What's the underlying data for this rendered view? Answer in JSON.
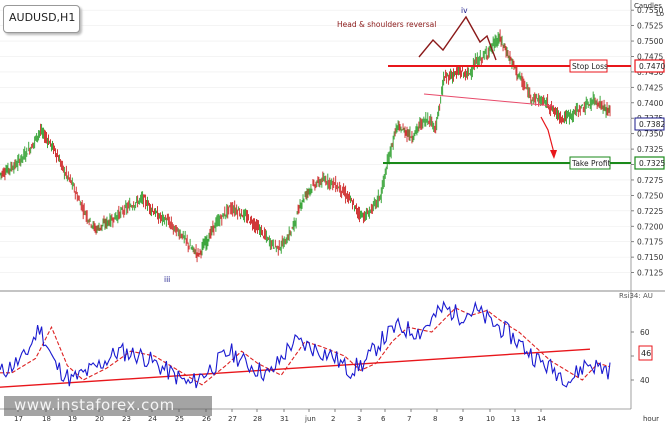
{
  "header": {
    "symbol": "AUDUSD,H1",
    "price_axis_title": "Candles",
    "price_axis_sub": "Lo"
  },
  "watermark": "www.instaforex.com",
  "oscillator": {
    "label": "Rsi34: AU",
    "current_value": "46"
  },
  "axis": {
    "time_unit": "hour"
  },
  "annotations": {
    "pattern": "Head & shoulders reversal",
    "wave_top": "iv",
    "wave_bottom": "iii"
  },
  "levels": {
    "stop_loss": {
      "label": "Stop Loss",
      "price": "0.7470",
      "color": "#e8161b"
    },
    "take_profit": {
      "label": "Take Profit",
      "price": "0.7325",
      "color": "#1a8a1a"
    },
    "current_price": "0.7382"
  },
  "colors": {
    "up_candle": "#2a9d2a",
    "down_candle": "#cc2222",
    "rsi": "#1a1ad0",
    "rsi_ma": "#dd2222",
    "trend": "#e8161b",
    "neckline": "#e84a6a"
  },
  "chart_data": {
    "type": "candlestick",
    "x_labels": [
      "17",
      "18",
      "19",
      "20",
      "23",
      "24",
      "25",
      "26",
      "27",
      "28",
      "31",
      "jun",
      "2",
      "3",
      "6",
      "7",
      "8",
      "9",
      "10",
      "13",
      "14"
    ],
    "y_ticks": [
      "0.7550",
      "0.7525",
      "0.7500",
      "0.7475",
      "0.7450",
      "0.7425",
      "0.7400",
      "0.7375",
      "0.7350",
      "0.7325",
      "0.7300",
      "0.7275",
      "0.7250",
      "0.7225",
      "0.7200",
      "0.7175",
      "0.7150",
      "0.7125"
    ],
    "ylim": [
      0.71,
      0.756
    ],
    "close_path": [
      [
        0,
        0.7285
      ],
      [
        2,
        0.73
      ],
      [
        4,
        0.733
      ],
      [
        5,
        0.7355
      ],
      [
        6,
        0.734
      ],
      [
        7,
        0.732
      ],
      [
        8,
        0.729
      ],
      [
        9,
        0.727
      ],
      [
        10,
        0.724
      ],
      [
        11,
        0.7215
      ],
      [
        12,
        0.7195
      ],
      [
        14,
        0.721
      ],
      [
        16,
        0.723
      ],
      [
        18,
        0.7245
      ],
      [
        19,
        0.723
      ],
      [
        20,
        0.7215
      ],
      [
        21,
        0.721
      ],
      [
        22,
        0.7195
      ],
      [
        23,
        0.7185
      ],
      [
        24,
        0.7165
      ],
      [
        25,
        0.7155
      ],
      [
        26,
        0.7175
      ],
      [
        27,
        0.72
      ],
      [
        28,
        0.7215
      ],
      [
        29,
        0.723
      ],
      [
        30,
        0.7225
      ],
      [
        31,
        0.7215
      ],
      [
        32,
        0.7205
      ],
      [
        33,
        0.719
      ],
      [
        34,
        0.7175
      ],
      [
        35,
        0.7165
      ],
      [
        36,
        0.7175
      ],
      [
        37,
        0.72
      ],
      [
        38,
        0.724
      ],
      [
        39,
        0.726
      ],
      [
        40,
        0.727
      ],
      [
        41,
        0.7275
      ],
      [
        42,
        0.727
      ],
      [
        43,
        0.726
      ],
      [
        44,
        0.7245
      ],
      [
        45,
        0.7225
      ],
      [
        46,
        0.7215
      ],
      [
        47,
        0.723
      ],
      [
        48,
        0.725
      ],
      [
        49,
        0.731
      ],
      [
        50,
        0.736
      ],
      [
        51,
        0.7355
      ],
      [
        52,
        0.7345
      ],
      [
        53,
        0.7365
      ],
      [
        54,
        0.7375
      ],
      [
        55,
        0.736
      ],
      [
        56,
        0.744
      ],
      [
        57,
        0.7445
      ],
      [
        58,
        0.745
      ],
      [
        59,
        0.7445
      ],
      [
        60,
        0.7465
      ],
      [
        61,
        0.7475
      ],
      [
        62,
        0.749
      ],
      [
        63,
        0.7505
      ],
      [
        64,
        0.748
      ],
      [
        65,
        0.7455
      ],
      [
        66,
        0.743
      ],
      [
        67,
        0.741
      ],
      [
        68,
        0.7405
      ],
      [
        69,
        0.74
      ],
      [
        70,
        0.7385
      ],
      [
        71,
        0.7375
      ],
      [
        72,
        0.738
      ],
      [
        73,
        0.739
      ],
      [
        74,
        0.7395
      ],
      [
        75,
        0.7405
      ],
      [
        76,
        0.7395
      ],
      [
        77,
        0.7382
      ]
    ],
    "rsi": {
      "ylim": [
        30,
        75
      ],
      "ticks": [
        "60",
        "50",
        "40"
      ],
      "trendline": [
        [
          0,
          37
        ],
        [
          77,
          52
        ]
      ],
      "path": [
        [
          0,
          43
        ],
        [
          3,
          49
        ],
        [
          5,
          62
        ],
        [
          7,
          46
        ],
        [
          9,
          40
        ],
        [
          12,
          45
        ],
        [
          15,
          52
        ],
        [
          18,
          50
        ],
        [
          21,
          44
        ],
        [
          24,
          38
        ],
        [
          27,
          46
        ],
        [
          29,
          52
        ],
        [
          31,
          47
        ],
        [
          34,
          42
        ],
        [
          37,
          56
        ],
        [
          39,
          54
        ],
        [
          42,
          50
        ],
        [
          44,
          44
        ],
        [
          46,
          47
        ],
        [
          48,
          56
        ],
        [
          50,
          62
        ],
        [
          53,
          60
        ],
        [
          56,
          70
        ],
        [
          58,
          67
        ],
        [
          60,
          69
        ],
        [
          62,
          64
        ],
        [
          64,
          60
        ],
        [
          66,
          54
        ],
        [
          68,
          48
        ],
        [
          70,
          44
        ],
        [
          72,
          40
        ],
        [
          74,
          47
        ],
        [
          76,
          45
        ],
        [
          77,
          44
        ]
      ]
    }
  }
}
